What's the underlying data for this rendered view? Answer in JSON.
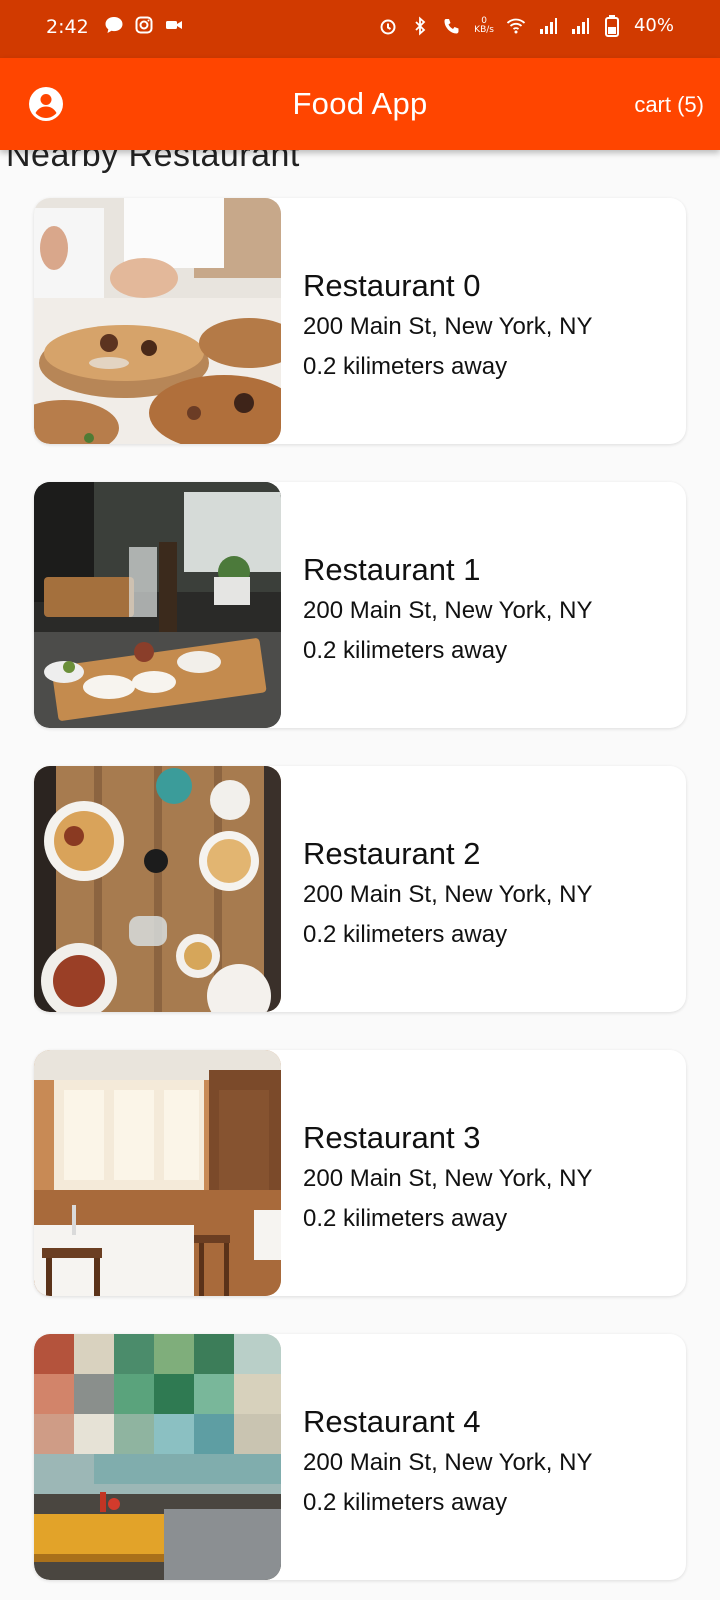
{
  "status_bar": {
    "time": "2:42",
    "data_speed_value": "0",
    "data_speed_unit": "KB/s",
    "battery": "40%"
  },
  "app_bar": {
    "title": "Food App",
    "cart": "cart (5)"
  },
  "section": {
    "title": "Nearby Restaurant"
  },
  "restaurants": [
    {
      "name": "Restaurant 0",
      "address": "200 Main St, New York, NY",
      "distance": "0.2 kilimeters away"
    },
    {
      "name": "Restaurant 1",
      "address": "200 Main St, New York, NY",
      "distance": "0.2 kilimeters away"
    },
    {
      "name": "Restaurant 2",
      "address": "200 Main St, New York, NY",
      "distance": "0.2 kilimeters away"
    },
    {
      "name": "Restaurant 3",
      "address": "200 Main St, New York, NY",
      "distance": "0.2 kilimeters away"
    },
    {
      "name": "Restaurant 4",
      "address": "200 Main St, New York, NY",
      "distance": "0.2 kilimeters away"
    }
  ],
  "colors": {
    "app_bar": "#ff4500",
    "status_bar": "#d13a00",
    "background": "#fafafa"
  }
}
